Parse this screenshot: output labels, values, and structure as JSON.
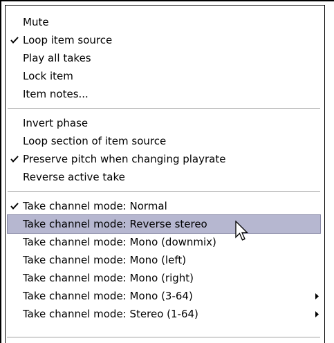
{
  "menu": {
    "groups": [
      {
        "items": [
          {
            "label": "Mute",
            "checked": false
          },
          {
            "label": "Loop item source",
            "checked": true
          },
          {
            "label": "Play all takes",
            "checked": false
          },
          {
            "label": "Lock item",
            "checked": false
          },
          {
            "label": "Item notes...",
            "checked": false
          }
        ]
      },
      {
        "items": [
          {
            "label": "Invert phase",
            "checked": false
          },
          {
            "label": "Loop section of item source",
            "checked": false
          },
          {
            "label": "Preserve pitch when changing playrate",
            "checked": true
          },
          {
            "label": "Reverse active take",
            "checked": false
          }
        ]
      },
      {
        "items": [
          {
            "label": "Take channel mode: Normal",
            "checked": true
          },
          {
            "label": "Take channel mode: Reverse stereo",
            "checked": false,
            "highlighted": true
          },
          {
            "label": "Take channel mode: Mono (downmix)",
            "checked": false
          },
          {
            "label": "Take channel mode: Mono (left)",
            "checked": false
          },
          {
            "label": "Take channel mode: Mono (right)",
            "checked": false
          },
          {
            "label": "Take channel mode: Mono (3-64)",
            "checked": false,
            "submenu": true
          },
          {
            "label": "Take channel mode: Stereo (1-64)",
            "checked": false,
            "submenu": true
          }
        ]
      }
    ],
    "icons": {
      "check": "checkmark-icon",
      "submenu": "submenu-arrow-icon",
      "cursor": "mouse-pointer-icon"
    },
    "colors": {
      "highlight": "#b6b7d0",
      "separator": "#a0a0a0",
      "text": "#000000",
      "background": "#ffffff"
    }
  }
}
